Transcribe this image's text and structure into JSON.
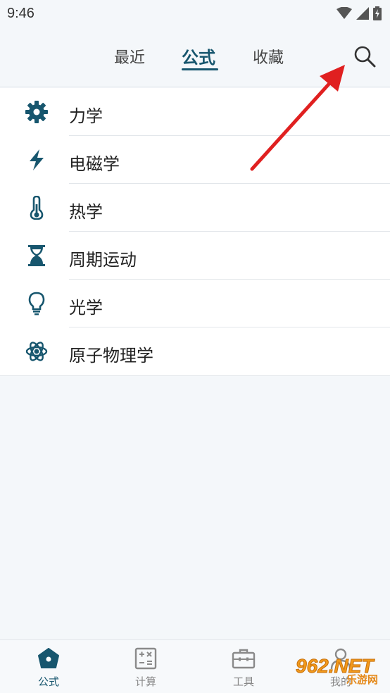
{
  "status_bar": {
    "time": "9:46"
  },
  "header": {
    "tabs": [
      {
        "label": "最近",
        "active": false
      },
      {
        "label": "公式",
        "active": true
      },
      {
        "label": "收藏",
        "active": false
      }
    ],
    "search_icon": "search-icon"
  },
  "categories": [
    {
      "label": "力学",
      "icon": "gear-icon"
    },
    {
      "label": "电磁学",
      "icon": "lightning-icon"
    },
    {
      "label": "热学",
      "icon": "thermometer-icon"
    },
    {
      "label": "周期运动",
      "icon": "hourglass-icon"
    },
    {
      "label": "光学",
      "icon": "lightbulb-icon"
    },
    {
      "label": "原子物理学",
      "icon": "atom-icon"
    }
  ],
  "bottom_nav": [
    {
      "label": "公式",
      "icon": "home-icon",
      "active": true
    },
    {
      "label": "计算",
      "icon": "calculator-icon",
      "active": false
    },
    {
      "label": "工具",
      "icon": "toolbox-icon",
      "active": false
    },
    {
      "label": "我的",
      "icon": "person-icon",
      "active": false
    }
  ],
  "watermark": {
    "logo_text": "962.NET",
    "sub_text": "乐游网"
  },
  "colors": {
    "accent": "#17566e",
    "background": "#f4f7fa",
    "arrow": "#e02020"
  }
}
